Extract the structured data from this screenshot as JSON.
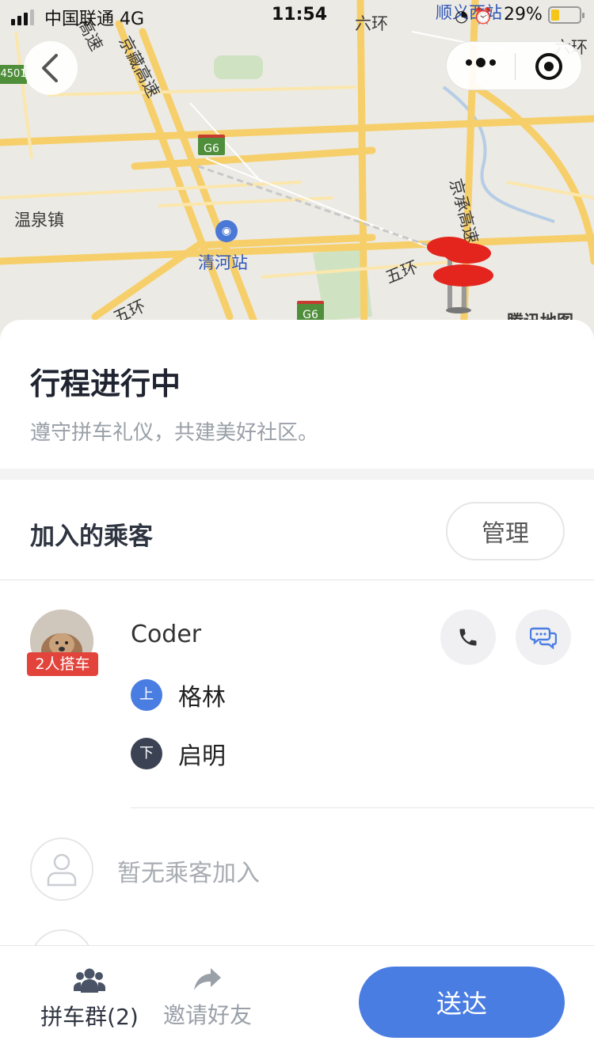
{
  "status_bar": {
    "carrier": "中国联通",
    "network": "4G",
    "time": "11:54",
    "battery_percent": "29%",
    "battery_level": 0.29,
    "battery_color": "#f5c518"
  },
  "map": {
    "labels": {
      "liuhuan_top": "六环",
      "shunyi_west": "顺义西站",
      "liuhuan_right": "六环",
      "jingzang": "京藏高速",
      "xinghigh": "高速",
      "jingcheng": "京承高速",
      "wenquan": "温泉镇",
      "qinghe": "清河站",
      "wuhuan_right": "五环",
      "wuhuan_left": "五环",
      "tencent": "腾讯地图"
    },
    "shields": {
      "g6_top": "G6",
      "g6_bottom": "G6",
      "s4501": "4501"
    },
    "icons": {
      "back": "chevron-left-icon",
      "more": "more-dots-icon",
      "close": "target-circle-icon",
      "pin": "map-pin-icon",
      "station": "train-station-icon"
    }
  },
  "trip": {
    "title": "行程进行中",
    "subtitle": "遵守拼车礼仪，共建美好社区。"
  },
  "passengers": {
    "section_title": "加入的乘客",
    "manage_label": "管理",
    "items": [
      {
        "name": "Coder",
        "badge": "2人搭车",
        "pickup_tag": "上",
        "pickup": "格林",
        "dropoff_tag": "下",
        "dropoff": "启明"
      }
    ],
    "empty_text": "暂无乘客加入"
  },
  "bottom_bar": {
    "group_label": "拼车群(2)",
    "invite_label": "邀请好友",
    "deliver_label": "送达"
  },
  "colors": {
    "primary": "#4a7de2",
    "badge_red": "#e2443c",
    "dropoff_dark": "#3a4254"
  }
}
